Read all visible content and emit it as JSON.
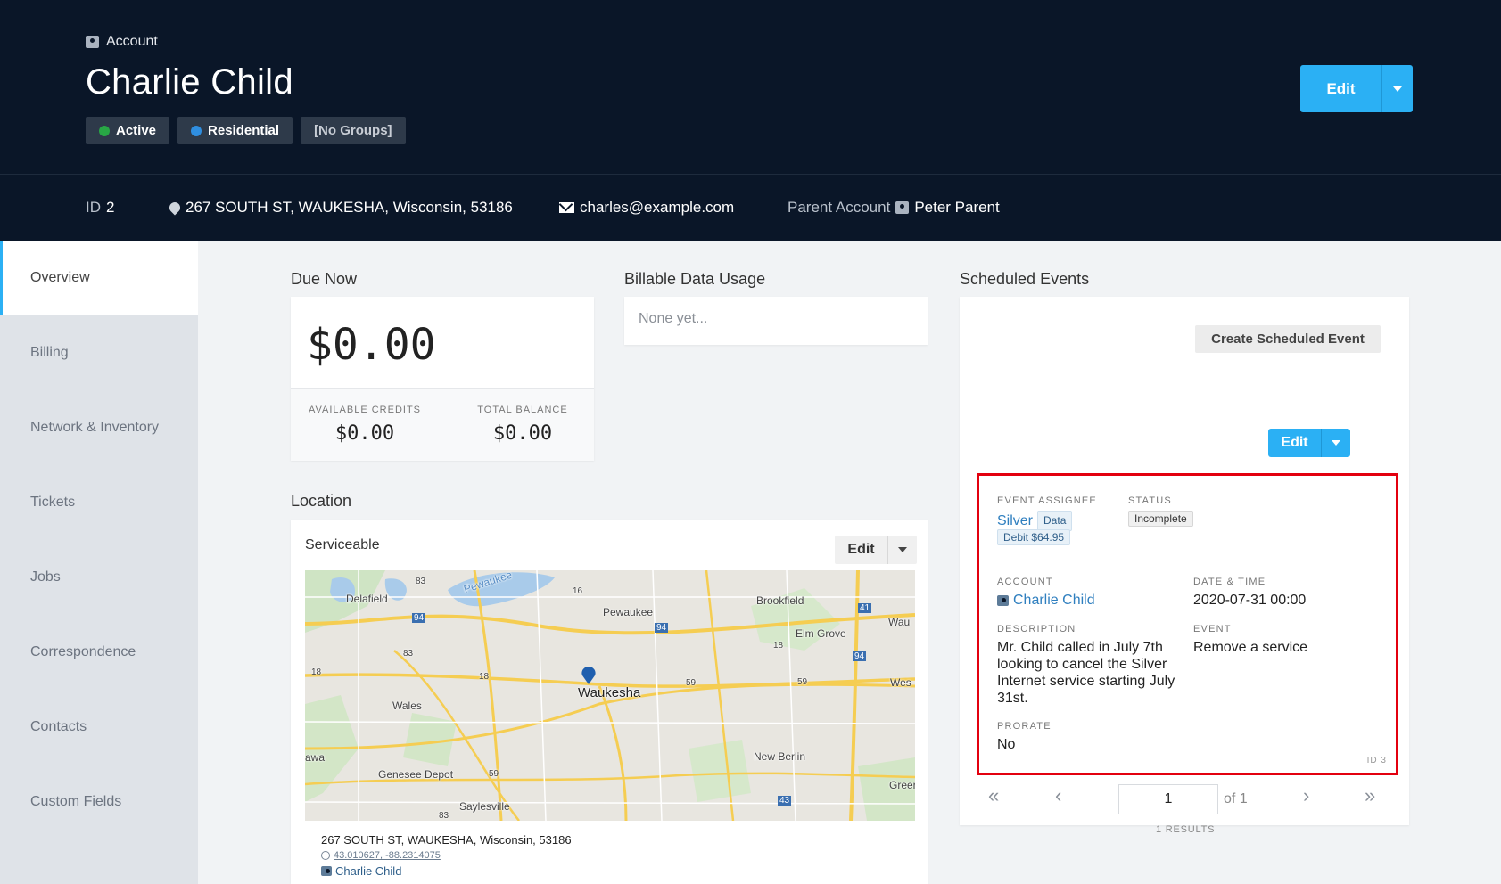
{
  "header": {
    "crumb": "Account",
    "title": "Charlie Child",
    "badges": [
      {
        "label": "Active",
        "color": "#28a745"
      },
      {
        "label": "Residential",
        "color": "#2f8ee0"
      },
      {
        "label": "[No Groups]"
      }
    ],
    "edit_label": "Edit"
  },
  "info": {
    "id_label": "ID",
    "id_value": "2",
    "address": "267 SOUTH ST, WAUKESHA, Wisconsin, 53186",
    "email": "charles@example.com",
    "parent_label": "Parent Account",
    "parent_value": "Peter Parent"
  },
  "sidebar": {
    "items": [
      {
        "label": "Overview",
        "active": true
      },
      {
        "label": "Billing"
      },
      {
        "label": "Network & Inventory"
      },
      {
        "label": "Tickets"
      },
      {
        "label": "Jobs"
      },
      {
        "label": "Correspondence"
      },
      {
        "label": "Contacts"
      },
      {
        "label": "Custom Fields"
      }
    ]
  },
  "due": {
    "title": "Due Now",
    "amount": "$0.00",
    "credits_label": "AVAILABLE CREDITS",
    "credits_value": "$0.00",
    "balance_label": "TOTAL BALANCE",
    "balance_value": "$0.00"
  },
  "usage": {
    "title": "Billable Data Usage",
    "empty": "None yet..."
  },
  "location": {
    "title": "Location",
    "status": "Serviceable",
    "edit_label": "Edit",
    "address": "267 SOUTH ST, WAUKESHA, Wisconsin, 53186",
    "coords": "43.010627, -88.2314075",
    "account": "Charlie Child",
    "map_labels": {
      "delafield": "Delafield",
      "pewaukee_lake": "Pewaukee",
      "pewaukee": "Pewaukee",
      "brookfield": "Brookfield",
      "elm_grove": "Elm Grove",
      "wau": "Wau",
      "waukesha": "Waukesha",
      "wales": "Wales",
      "wes": "Wes",
      "awa": "awa",
      "genesee": "Genesee Depot",
      "new_berlin": "New Berlin",
      "saylesville": "Saylesville",
      "greer": "Greer",
      "r83a": "83",
      "r16": "16",
      "r94a": "94",
      "r94b": "94",
      "r41": "41",
      "r83b": "83",
      "r18a": "18",
      "r18b": "18",
      "r18c": "18",
      "r59a": "59",
      "r59b": "59",
      "r59c": "59",
      "r94c": "94",
      "r43": "43",
      "r83c": "83"
    }
  },
  "events": {
    "title": "Scheduled Events",
    "create_label": "Create Scheduled Event",
    "edit_label": "Edit",
    "assignee_label": "EVENT ASSIGNEE",
    "assignee_value": "Silver",
    "assignee_tag": "Data",
    "assignee_debit": "Debit $64.95",
    "status_label": "STATUS",
    "status_value": "Incomplete",
    "account_label": "ACCOUNT",
    "account_value": "Charlie Child",
    "datetime_label": "DATE & TIME",
    "datetime_value": "2020-07-31 00:00",
    "description_label": "DESCRIPTION",
    "description_value": "Mr. Child called in July 7th looking to cancel the Silver Internet service starting July 31st.",
    "event_label": "EVENT",
    "event_value": "Remove a service",
    "prorate_label": "PRORATE",
    "prorate_value": "No",
    "id_value": "ID 3",
    "page_value": "1",
    "page_of": "of 1",
    "results": "1 RESULTS",
    "highlight_color": "#e3000f"
  },
  "colors": {
    "header_bg": "#0a1628",
    "accent": "#2bb0f4"
  },
  "icons": [
    "account-icon",
    "pin-icon",
    "mail-icon",
    "chevron-down-icon",
    "globe-icon",
    "first-page-icon",
    "prev-page-icon",
    "next-page-icon",
    "last-page-icon"
  ]
}
